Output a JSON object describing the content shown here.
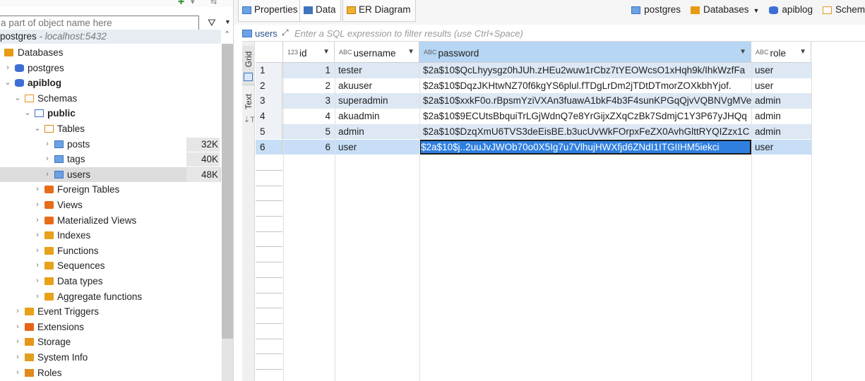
{
  "colors": {
    "accent": "#2f7fe0",
    "selection": "#c7def6",
    "stripe": "#dde8f4"
  },
  "navigator": {
    "filter_placeholder": "a part of object name here",
    "connection_name": "postgres",
    "connection_host": " - localhost:5432",
    "tree": [
      {
        "label": "Databases",
        "level": 0,
        "icon": "database-folder-icon",
        "expanded": true,
        "chev": ""
      },
      {
        "label": "postgres",
        "level": 1,
        "icon": "database-icon",
        "chev": "›"
      },
      {
        "label": "apiblog",
        "level": 1,
        "icon": "database-icon",
        "chev": "⌄",
        "bold": true
      },
      {
        "label": "Schemas",
        "level": 2,
        "icon": "schemas-icon",
        "chev": "⌄"
      },
      {
        "label": "public",
        "level": 3,
        "icon": "schema-icon",
        "chev": "⌄",
        "bold": true
      },
      {
        "label": "Tables",
        "level": 4,
        "icon": "tables-icon",
        "chev": "⌄"
      },
      {
        "label": "posts",
        "level": 5,
        "icon": "table-icon",
        "chev": "›",
        "size": "32K"
      },
      {
        "label": "tags",
        "level": 5,
        "icon": "table-icon",
        "chev": "›",
        "size": "40K"
      },
      {
        "label": "users",
        "level": 5,
        "icon": "table-icon",
        "chev": "›",
        "size": "48K",
        "selected": true
      },
      {
        "label": "Foreign Tables",
        "level": 4,
        "icon": "foreign-tables-icon",
        "chev": "›"
      },
      {
        "label": "Views",
        "level": 4,
        "icon": "views-icon",
        "chev": "›"
      },
      {
        "label": "Materialized Views",
        "level": 4,
        "icon": "materialized-views-icon",
        "chev": "›"
      },
      {
        "label": "Indexes",
        "level": 4,
        "icon": "folder-icon",
        "chev": "›"
      },
      {
        "label": "Functions",
        "level": 4,
        "icon": "folder-icon",
        "chev": "›"
      },
      {
        "label": "Sequences",
        "level": 4,
        "icon": "folder-icon",
        "chev": "›"
      },
      {
        "label": "Data types",
        "level": 4,
        "icon": "folder-icon",
        "chev": "›"
      },
      {
        "label": "Aggregate functions",
        "level": 4,
        "icon": "folder-icon",
        "chev": "›"
      },
      {
        "label": "Event Triggers",
        "level": 2,
        "icon": "folder-icon",
        "chev": "›"
      },
      {
        "label": "Extensions",
        "level": 2,
        "icon": "extensions-icon",
        "chev": "›"
      },
      {
        "label": "Storage",
        "level": 2,
        "icon": "storage-icon",
        "chev": "›"
      },
      {
        "label": "System Info",
        "level": 2,
        "icon": "system-info-icon",
        "chev": "›"
      },
      {
        "label": "Roles",
        "level": 2,
        "icon": "roles-icon",
        "chev": "›"
      }
    ]
  },
  "editor": {
    "tabs": [
      {
        "label": "Properties",
        "icon": "properties-icon"
      },
      {
        "label": "Data",
        "icon": "data-icon",
        "active": true
      },
      {
        "label": "ER Diagram",
        "icon": "er-diagram-icon"
      }
    ],
    "breadcrumbs": [
      {
        "label": "postgres",
        "icon": "connection-icon"
      },
      {
        "label": "Databases",
        "icon": "databases-folder-icon",
        "dropdown": true
      },
      {
        "label": "apiblog",
        "icon": "database-icon"
      },
      {
        "label": "Schem",
        "icon": "schemas-icon"
      }
    ],
    "filter": {
      "table": "users",
      "placeholder": "Enter a SQL expression to filter results (use Ctrl+Space)"
    },
    "side_tabs": {
      "grid": "Grid",
      "text": "Text"
    },
    "grid": {
      "columns": [
        {
          "name": "id",
          "type": "123"
        },
        {
          "name": "username",
          "type": "ABC"
        },
        {
          "name": "password",
          "type": "ABC"
        },
        {
          "name": "role",
          "type": "ABC"
        }
      ],
      "rows": [
        {
          "n": "1",
          "id": "1",
          "username": "tester",
          "password": "$2a$10$QcLhyysgz0hJUh.zHEu2wuw1rCbz7tYEOWcsO1xHqh9k/IhkWzfFa",
          "role": "user"
        },
        {
          "n": "2",
          "id": "2",
          "username": "akuuser",
          "password": "$2a$10$DqzJKHtwNZ70f6kgYS6plul.fTDgLrDm2jTDtDTmorZOXkbhYjof.",
          "role": "user"
        },
        {
          "n": "3",
          "id": "3",
          "username": "superadmin",
          "password": "$2a$10$xxkF0o.rBpsmYziVXAn3fuawA1bkF4b3F4sunKPGqQjvVQBNVgMVe",
          "role": "admin"
        },
        {
          "n": "4",
          "id": "4",
          "username": "akuadmin",
          "password": "$2a$10$9ECUtsBbquiTrLGjWdnQ7e8YrGijxZXqCzBk7SdmjC1Y3P67yJHQq",
          "role": "admin"
        },
        {
          "n": "5",
          "id": "5",
          "username": "admin",
          "password": "$2a$10$DzqXmU6TVS3deEisBE.b3ucUvWkFOrpxFeZX0AvhGlttRYQIZzx1C",
          "role": "admin"
        },
        {
          "n": "6",
          "id": "6",
          "username": "user",
          "password": "$2a$10$j..2uuJvJWOb70o0X5Ig7u7VlhujHWXfjd6ZNdI1ITGIIHM5iekci",
          "role": "user"
        }
      ]
    }
  }
}
